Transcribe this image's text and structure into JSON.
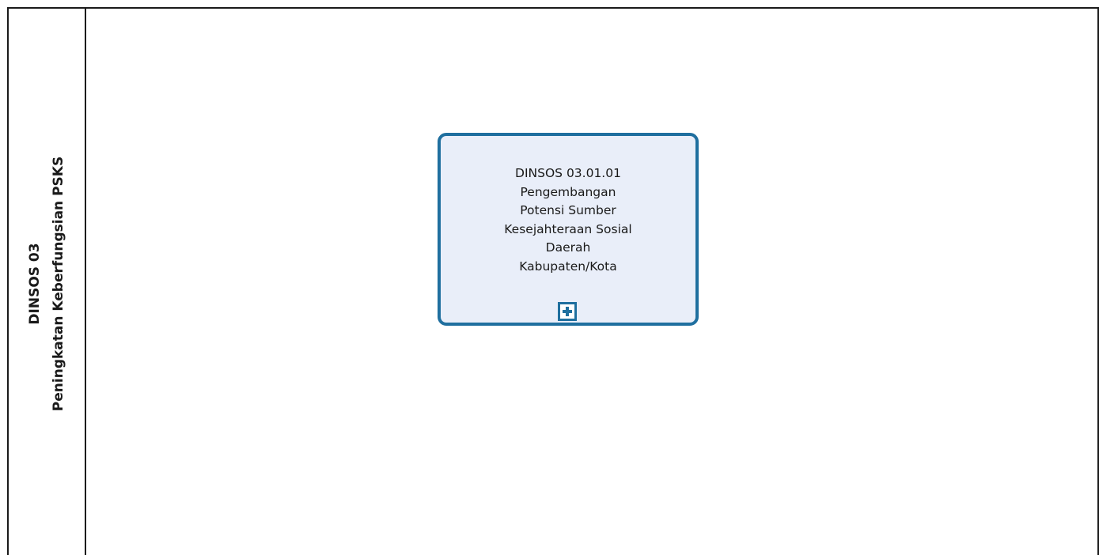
{
  "pool": {
    "lane": {
      "title_lines": [
        "DINSOS 03",
        "Peningkatan Keberfungsian PSKS"
      ]
    }
  },
  "task": {
    "label_lines": [
      "DINSOS 03.01.01",
      "Pengembangan",
      "Potensi Sumber",
      "Kesejahteraan Sosial",
      "Daerah",
      "Kabupaten/Kota"
    ],
    "marker": "plus-icon",
    "colors": {
      "border": "#1f6f9f",
      "fill": "#e9eef9"
    }
  }
}
